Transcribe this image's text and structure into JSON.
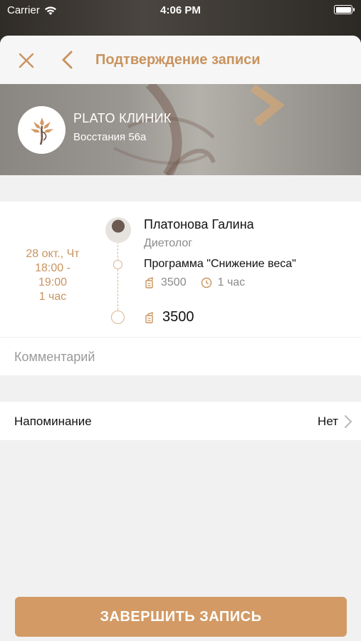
{
  "status_bar": {
    "carrier": "Carrier",
    "time": "4:06 PM"
  },
  "nav": {
    "title": "Подтверждение записи"
  },
  "clinic": {
    "name": "PLATO КЛИНИК",
    "address": "Восстания 56а"
  },
  "appointment": {
    "date": "28 окт., Чт",
    "time_range_start": "18:00 -",
    "time_range_end": "19:00",
    "duration": "1 час",
    "doctor_name": "Платонова Галина",
    "doctor_role": "Диетолог",
    "service_name": "Программа \"Снижение веса\"",
    "service_price": "3500",
    "service_duration": "1 час",
    "total_price": "3500"
  },
  "comment": {
    "placeholder": "Комментарий",
    "value": ""
  },
  "reminder": {
    "label": "Напоминание",
    "value": "Нет"
  },
  "finish_button": {
    "label": "ЗАВЕРШИТЬ ЗАПИСЬ"
  },
  "colors": {
    "accent": "#c9935e",
    "button": "#d39a65",
    "background": "#f1f1f1"
  },
  "icons": [
    "wifi-icon",
    "battery-icon",
    "close-icon",
    "back-chevron-icon",
    "clinic-logo-icon",
    "price-tag-icon",
    "clock-icon",
    "chevron-right-icon"
  ]
}
